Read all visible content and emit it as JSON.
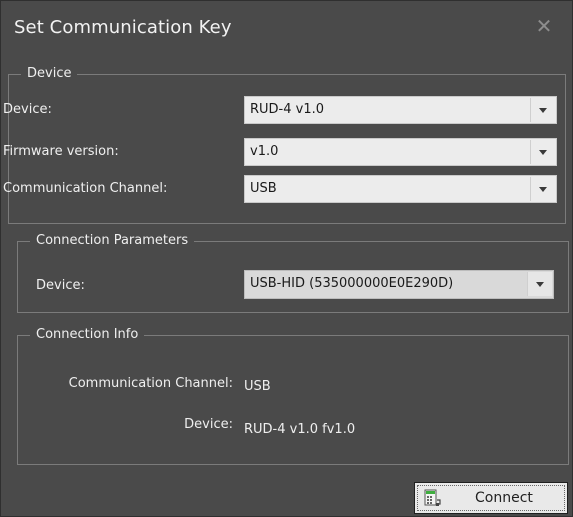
{
  "dialog": {
    "title": "Set Communication Key",
    "close_glyph": "✕"
  },
  "device_group": {
    "legend": "Device",
    "device_label": "Device:",
    "device_value": "RUD-4 v1.0",
    "firmware_label": "Firmware version:",
    "firmware_value": "v1.0",
    "channel_label": "Communication Channel:",
    "channel_value": "USB"
  },
  "connection_params": {
    "legend": "Connection Parameters",
    "device_label": "Device:",
    "device_value": "USB-HID (535000000E0E290D)"
  },
  "connection_info": {
    "legend": "Connection Info",
    "channel_label": "Communication Channel:",
    "channel_value": "USB",
    "device_label": "Device:",
    "device_value": "RUD-4 v1.0 fv1.0"
  },
  "footer": {
    "connect_label": "Connect",
    "connect_icon": "connect-device-icon"
  },
  "colors": {
    "dialog_bg": "#4a4a4a",
    "combo_bg": "#ececec",
    "text": "#f0f0f0"
  }
}
